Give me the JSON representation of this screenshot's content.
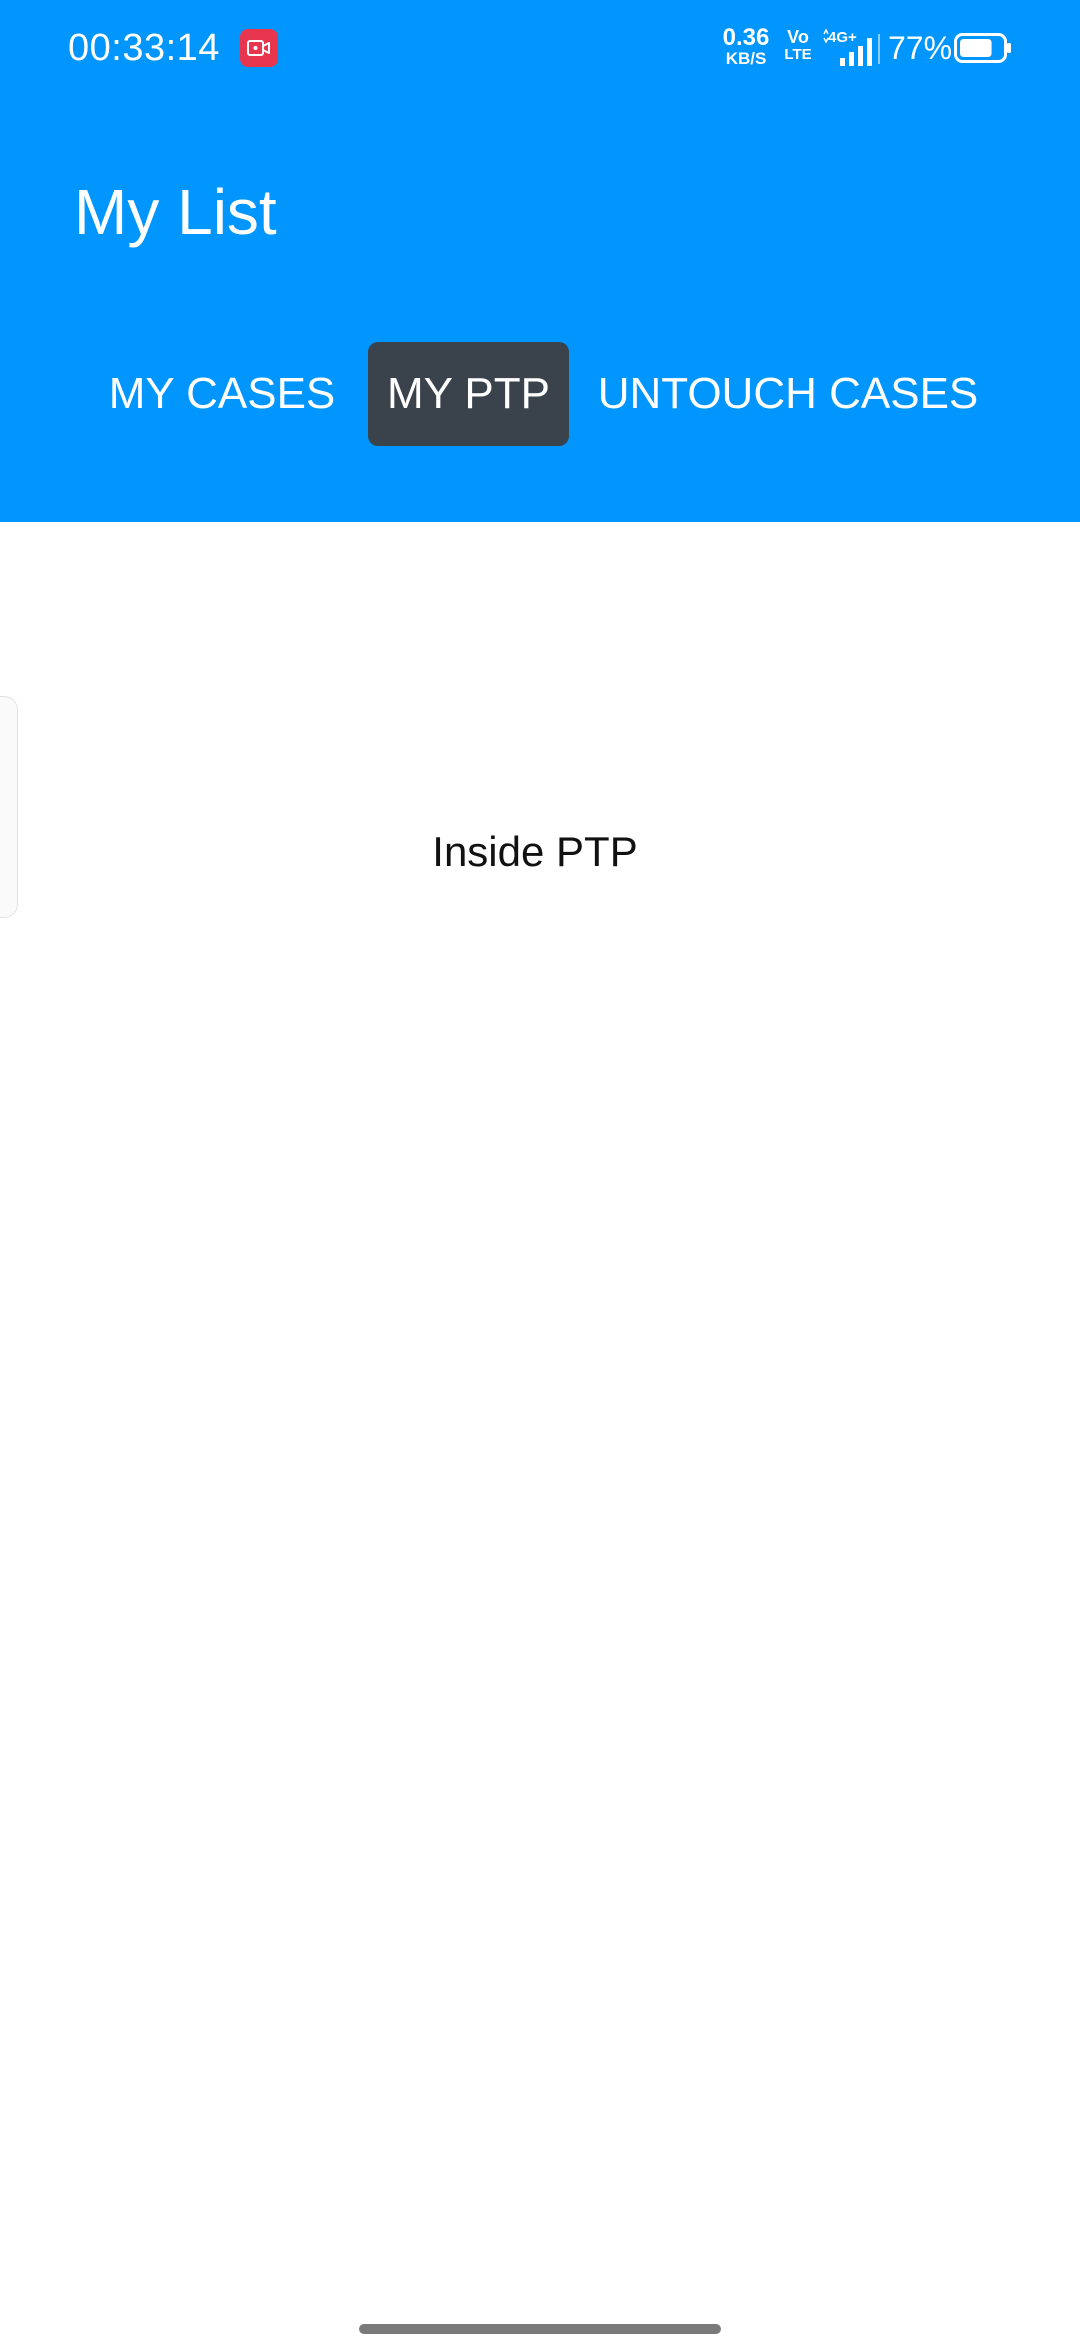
{
  "status_bar": {
    "time": "00:33:14",
    "record_icon": "screen-record-icon",
    "net_speed_value": "0.36",
    "net_speed_unit": "KB/S",
    "volte_top": "Vo",
    "volte_bottom": "LTE",
    "network": "4G+",
    "battery_percent": "77%",
    "battery_level": 0.77
  },
  "header": {
    "title": "My List",
    "background_color": "#0195fe"
  },
  "tabs": [
    {
      "label": "MY CASES",
      "selected": false
    },
    {
      "label": "MY PTP",
      "selected": true,
      "selected_color": "#3a434c"
    },
    {
      "label": "UNTOUCH CASES",
      "selected": false
    }
  ],
  "content": {
    "message": "Inside PTP"
  }
}
